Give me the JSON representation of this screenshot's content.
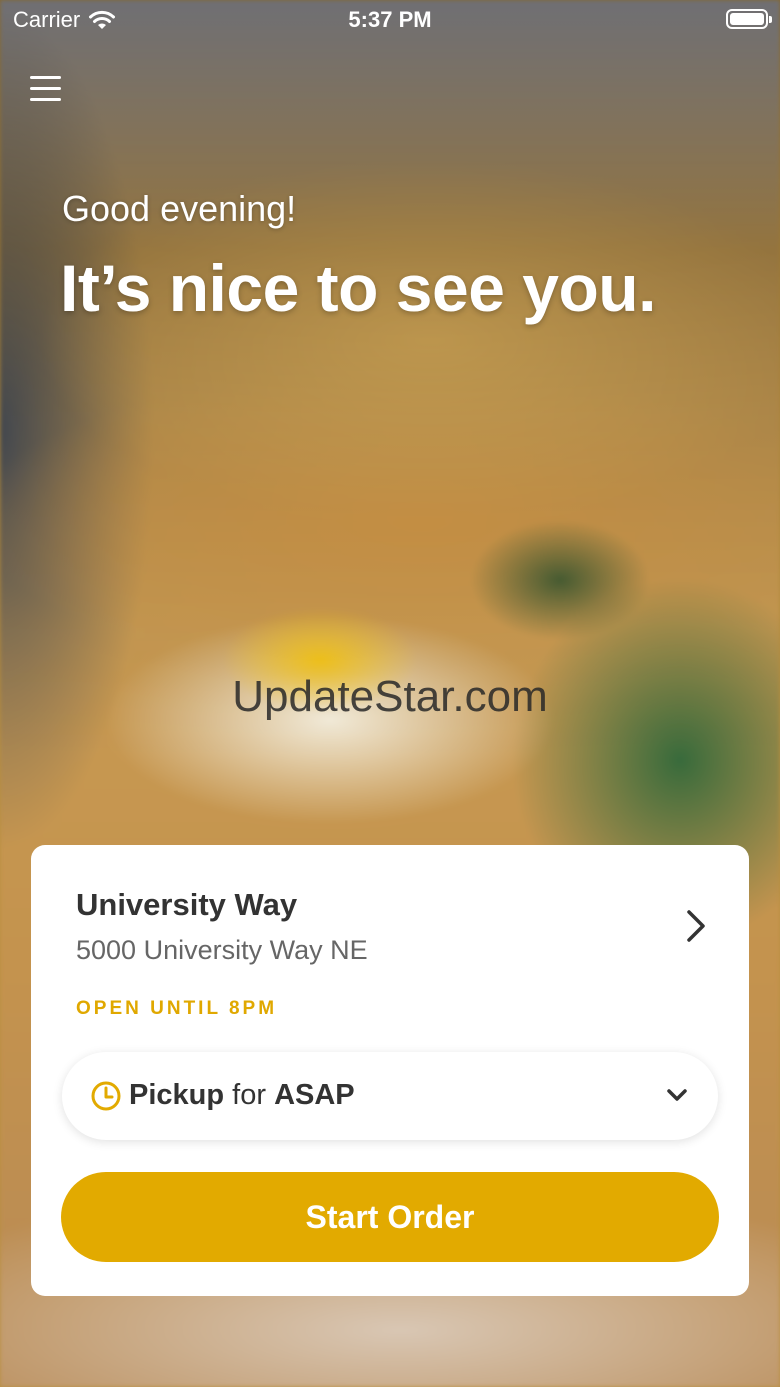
{
  "status_bar": {
    "carrier": "Carrier",
    "time": "5:37 PM"
  },
  "header": {
    "menu_icon": "hamburger-menu-icon"
  },
  "greeting": {
    "line1": "Good evening!",
    "line2": "It’s nice to see you."
  },
  "watermark": "UpdateStar.com",
  "location_card": {
    "store_name": "University Way",
    "address": "5000 University Way NE",
    "open_status": "OPEN UNTIL 8PM",
    "order_type": {
      "mode": "Pickup",
      "connector": "for",
      "time": "ASAP"
    },
    "start_button_label": "Start Order"
  },
  "colors": {
    "accent": "#e2aa00",
    "open_status": "#e0a800",
    "card_background": "#ffffff"
  }
}
